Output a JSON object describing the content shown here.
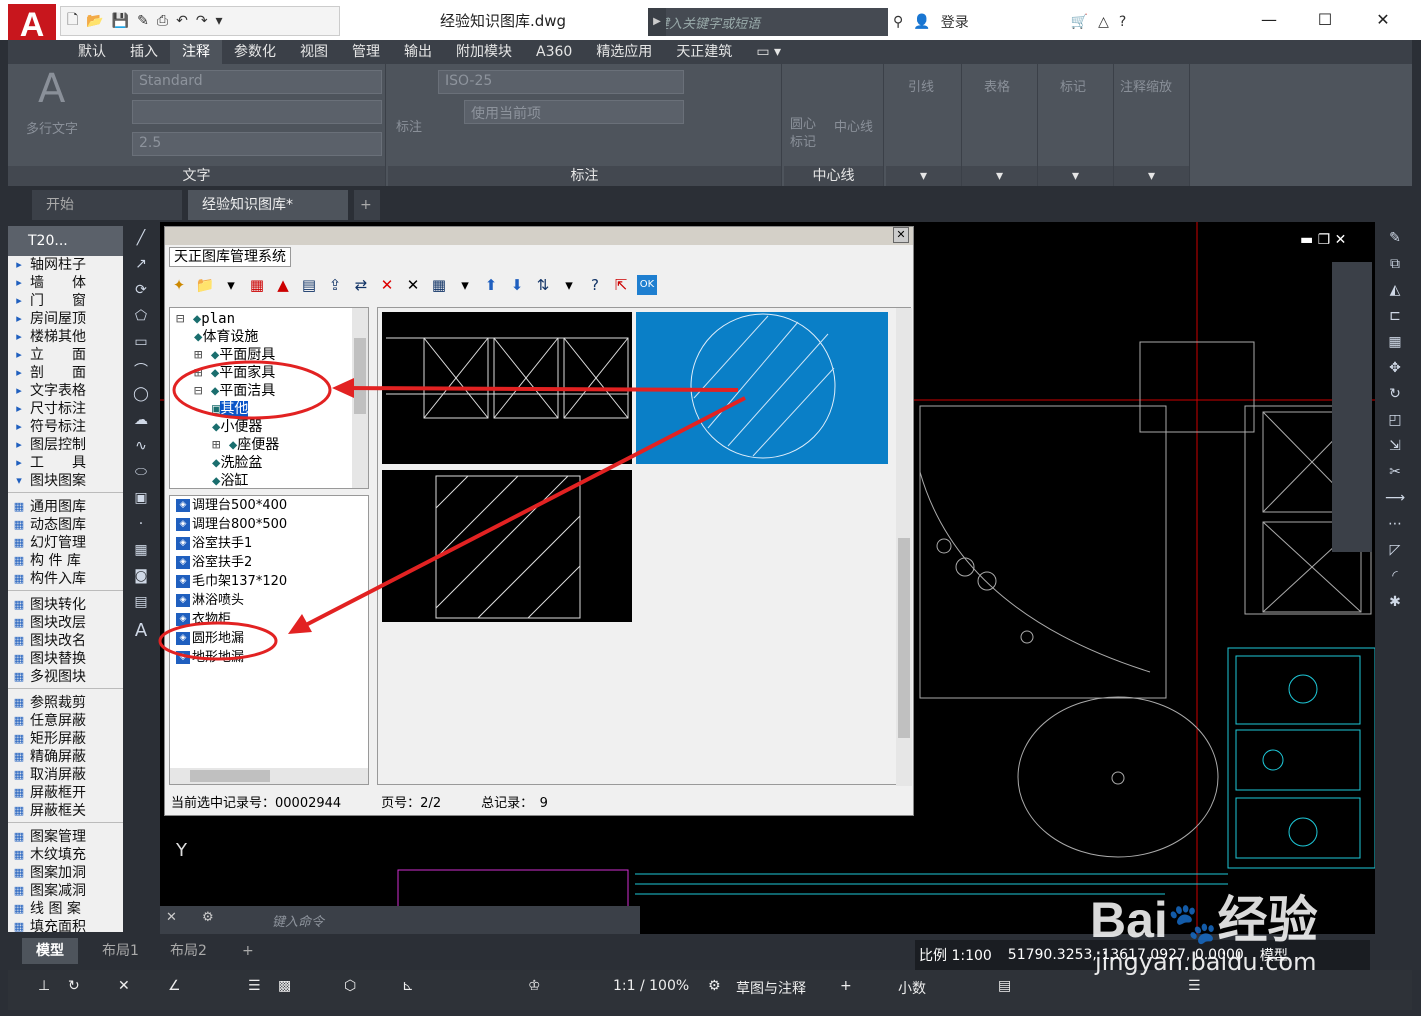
{
  "app": {
    "logo": "A",
    "doc_title": "经验知识图库.dwg"
  },
  "search": {
    "placeholder": "键入关键字或短语"
  },
  "account": {
    "login": "登录"
  },
  "ribbon_tabs": [
    "默认",
    "插入",
    "注释",
    "参数化",
    "视图",
    "管理",
    "输出",
    "附加模块",
    "A360",
    "精选应用",
    "天正建筑"
  ],
  "ribbon": {
    "text_panel": {
      "big_label": "多行文字",
      "style_combo": "Standard",
      "height_combo": "2.5",
      "title": "文字"
    },
    "dim_panel": {
      "style_combo": "ISO-25",
      "layer_combo": "使用当前项",
      "big_label": "标注",
      "title": "标注"
    },
    "center_panel": {
      "btn1": "圆心\n标记",
      "btn2": "中心线",
      "title": "中心线"
    },
    "more_panels": [
      "引线",
      "表格",
      "标记",
      "注释缩放"
    ]
  },
  "doc_tabs": [
    "开始",
    "经验知识图库*"
  ],
  "left_palette": {
    "header": "T20...",
    "group1": [
      "轴网柱子",
      "墙　　体",
      "门　　窗",
      "房间屋顶",
      "楼梯其他",
      "立　　面",
      "剖　　面",
      "文字表格",
      "尺寸标注",
      "符号标注",
      "图层控制",
      "工　　具",
      "图块图案"
    ],
    "group2": [
      "通用图库",
      "动态图库",
      "幻灯管理",
      "构 件 库",
      "构件入库"
    ],
    "group3": [
      "图块转化",
      "图块改层",
      "图块改名",
      "图块替换",
      "多视图块"
    ],
    "group4": [
      "参照裁剪",
      "任意屏蔽",
      "矩形屏蔽",
      "精确屏蔽",
      "取消屏蔽",
      "屏蔽框开",
      "屏蔽框关"
    ],
    "group5": [
      "图案管理",
      "木纹填充",
      "图案加洞",
      "图案减洞",
      "线 图 案",
      "填充面积"
    ]
  },
  "dialog": {
    "title": "天正图库管理系统",
    "tree": [
      "plan",
      "体育设施",
      "平面厨具",
      "平面家具",
      "平面洁具",
      "其他",
      "小便器",
      "座便器",
      "洗脸盆",
      "浴缸"
    ],
    "list": [
      "调理台500*400",
      "调理台800*500",
      "浴室扶手1",
      "浴室扶手2",
      "毛巾架137*120",
      "淋浴喷头",
      "衣物柜",
      "圆形地漏",
      "地形地漏"
    ],
    "status_record": "当前选中记录号：00002944",
    "status_page": "页号：2/2",
    "status_total": "总记录：　9"
  },
  "command": {
    "placeholder": "键入命令"
  },
  "layout_tabs": [
    "模型",
    "布局1",
    "布局2"
  ],
  "status": {
    "scale": "比例 1:100",
    "coords": "51790.3253, 13617.0927, 0.0000",
    "space": "模型",
    "annoscale": "1:1 / 100%",
    "workspace": "草图与注释",
    "units": "小数"
  },
  "watermark": {
    "brand": "Bai",
    "cn": "经验",
    "url": "jingyan.baidu.com"
  },
  "colors": {
    "accent_red": "#e22222",
    "selection_blue": "#0a7fc7",
    "cad_bg": "#000000"
  }
}
